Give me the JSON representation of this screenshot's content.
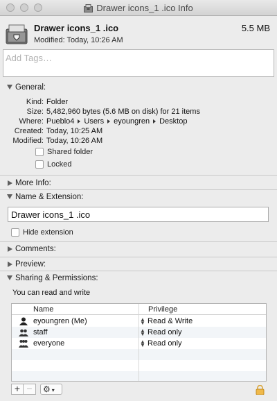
{
  "window": {
    "title": "Drawer icons_1 .ico Info"
  },
  "header": {
    "file_name": "Drawer icons_1 .ico",
    "file_size": "5.5 MB",
    "modified": "Modified: Today, 10:26 AM"
  },
  "tags": {
    "placeholder": "Add Tags…"
  },
  "general": {
    "title": "General:",
    "rows": [
      {
        "key": "Kind:",
        "value": "Folder"
      },
      {
        "key": "Size:",
        "value": "5,482,960 bytes (5.6 MB on disk) for 21 items"
      },
      {
        "key": "Where:",
        "path": [
          "Pueblo4",
          "Users",
          "eyoungren",
          "Desktop"
        ]
      },
      {
        "key": "Created:",
        "value": "Today, 10:25 AM"
      },
      {
        "key": "Modified:",
        "value": "Today, 10:26 AM"
      }
    ],
    "shared_folder": "Shared folder",
    "locked": "Locked"
  },
  "more_info": {
    "title": "More Info:"
  },
  "name_extension": {
    "title": "Name & Extension:",
    "value": "Drawer icons_1 .ico",
    "hide_extension": "Hide extension"
  },
  "comments": {
    "title": "Comments:"
  },
  "preview": {
    "title": "Preview:"
  },
  "sharing": {
    "title": "Sharing & Permissions:",
    "summary": "You can read and write",
    "col_name": "Name",
    "col_privilege": "Privilege",
    "rows": [
      {
        "name": "eyoungren (Me)",
        "privilege": "Read & Write",
        "icon": "single-user-icon"
      },
      {
        "name": "staff",
        "privilege": "Read only",
        "icon": "group-icon"
      },
      {
        "name": "everyone",
        "privilege": "Read only",
        "icon": "everyone-icon"
      }
    ],
    "add": "+",
    "remove": "−"
  }
}
